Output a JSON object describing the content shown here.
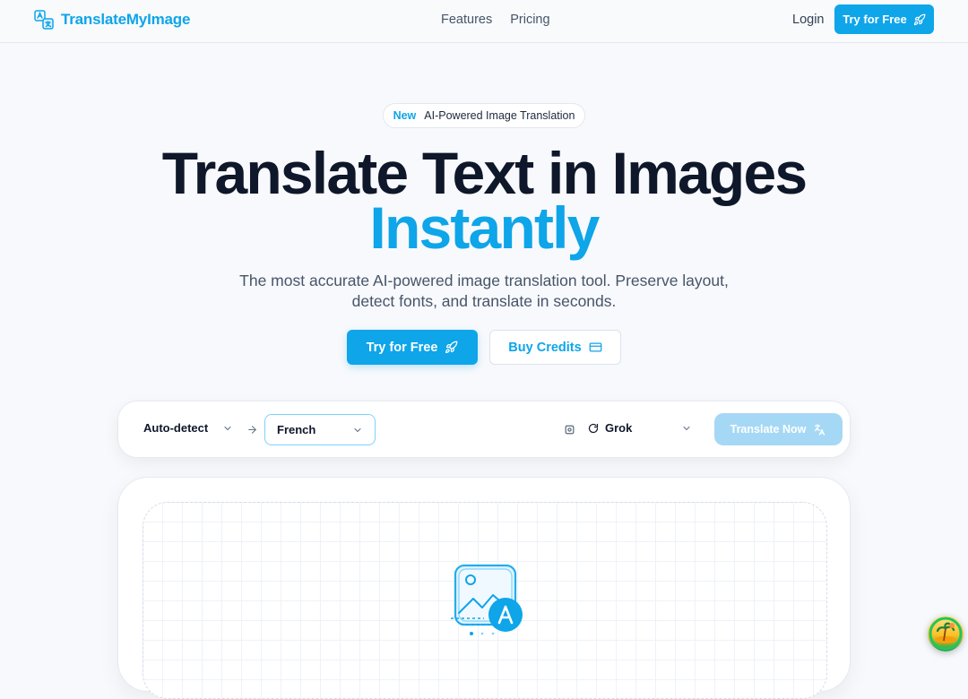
{
  "header": {
    "logo_text": "TranslateMyImage",
    "nav": [
      "Features",
      "Pricing"
    ],
    "login_label": "Login",
    "cta_label": "Try for Free"
  },
  "badge": {
    "new_label": "New",
    "text": "AI-Powered Image Translation"
  },
  "hero": {
    "title_line1": "Translate Text in Images",
    "title_line2": "Instantly",
    "subtitle_line1": "The most accurate AI-powered image translation tool. Preserve layout,",
    "subtitle_line2": "detect fonts, and translate in seconds.",
    "primary_cta": "Try for Free",
    "secondary_cta": "Buy Credits"
  },
  "toolbar": {
    "source_language": "Auto-detect",
    "target_language": "French",
    "model": "Grok",
    "translate_label": "Translate Now"
  },
  "colors": {
    "accent": "#0ea5e9",
    "translate_disabled": "#a5d8f5",
    "heading": "#0f172a"
  },
  "icons": {
    "logo": "translate-logo-icon",
    "rocket": "rocket-icon",
    "credit_card": "credit-card-icon",
    "chevron": "chevron-down-icon",
    "arrow": "arrow-right-icon",
    "settings": "settings-icon",
    "refresh": "refresh-icon",
    "translate": "translate-icon",
    "upload": "image-translate-icon"
  }
}
